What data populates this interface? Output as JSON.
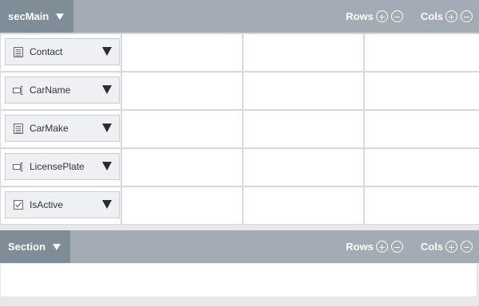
{
  "sections": [
    {
      "name": "secMain",
      "rows_label": "Rows",
      "cols_label": "Cols",
      "plus_glyph": "+",
      "minus_glyph": "−"
    },
    {
      "name": "Section",
      "rows_label": "Rows",
      "cols_label": "Cols",
      "plus_glyph": "+",
      "minus_glyph": "−"
    }
  ],
  "fields": [
    {
      "label": "Contact",
      "icon": "list-icon"
    },
    {
      "label": "CarName",
      "icon": "textbox-icon"
    },
    {
      "label": "CarMake",
      "icon": "list-icon"
    },
    {
      "label": "LicensePlate",
      "icon": "textbox-icon"
    },
    {
      "label": "IsActive",
      "icon": "checkbox-icon"
    }
  ],
  "colors": {
    "header_bg": "#a3acb4",
    "tab_bg": "#7f8d98",
    "chip_bg": "#eef0f4"
  }
}
